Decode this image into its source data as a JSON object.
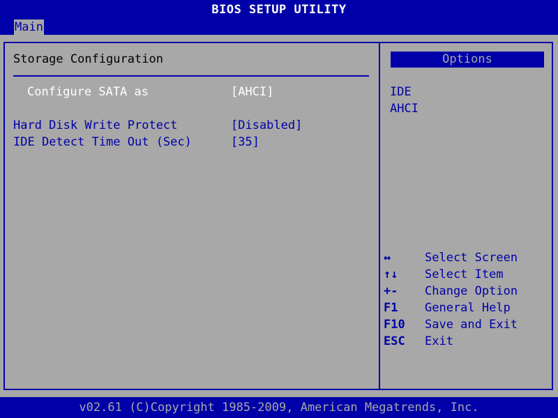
{
  "window": {
    "title": "BIOS SETUP UTILITY"
  },
  "menu": {
    "tabs": [
      {
        "label": "Main",
        "active": true
      }
    ]
  },
  "main": {
    "section_title": "Storage Configuration",
    "settings": [
      {
        "label": "Configure SATA as",
        "value": "[AHCI]",
        "selected": true
      },
      {
        "label": "Hard Disk Write Protect",
        "value": "[Disabled]"
      },
      {
        "label": "IDE Detect Time Out (Sec)",
        "value": "[35]"
      }
    ]
  },
  "options_panel": {
    "header": "Options",
    "items": [
      "IDE",
      "AHCI"
    ],
    "help": [
      {
        "key": "↔",
        "desc": "Select Screen"
      },
      {
        "key": "↑↓",
        "desc": "Select Item"
      },
      {
        "key": "+-",
        "desc": "Change Option"
      },
      {
        "key": "F1",
        "desc": "General Help"
      },
      {
        "key": "F10",
        "desc": "Save and Exit"
      },
      {
        "key": "ESC",
        "desc": "Exit"
      }
    ]
  },
  "footer": {
    "text": "v02.61 (C)Copyright 1985-2009, American Megatrends, Inc."
  },
  "colors": {
    "background": "#0000a8",
    "panel": "#a8a8a8",
    "highlight_text": "#ffffff"
  }
}
